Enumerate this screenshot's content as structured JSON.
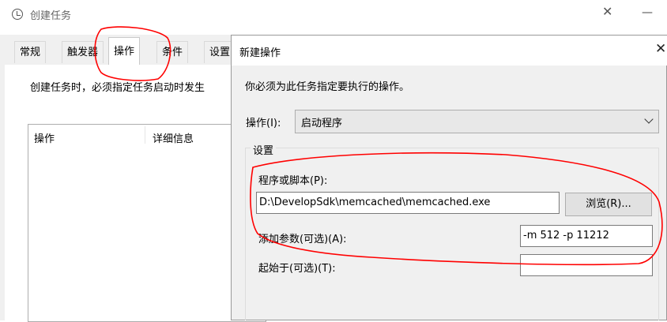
{
  "background_window": {
    "title": "创建任务",
    "close_glyph": "✕",
    "tabs": [
      {
        "label": "常规"
      },
      {
        "label": "触发器"
      },
      {
        "label": "操作"
      },
      {
        "label": "条件"
      },
      {
        "label": "设置"
      }
    ],
    "description": "创建任务时，必须指定任务启动时发生",
    "list_columns": [
      "操作",
      "详细信息"
    ]
  },
  "desktop": {
    "minimize_glyph": "—"
  },
  "dialog": {
    "title": "新建操作",
    "close_glyph": "✕",
    "instruction": "你必须为此任务指定要执行的操作。",
    "action_label": "操作(I):",
    "action_value": "启动程序",
    "settings_legend": "设置",
    "program_label": "程序或脚本(P):",
    "program_value": "D:\\DevelopSdk\\memcached\\memcached.exe",
    "browse_label": "浏览(R)...",
    "arguments_label": "添加参数(可选)(A):",
    "arguments_value": "-m 512 -p 11212",
    "start_in_label": "起始于(可选)(T):",
    "start_in_value": ""
  },
  "annotations": {
    "stroke_color": "#ff0000"
  }
}
